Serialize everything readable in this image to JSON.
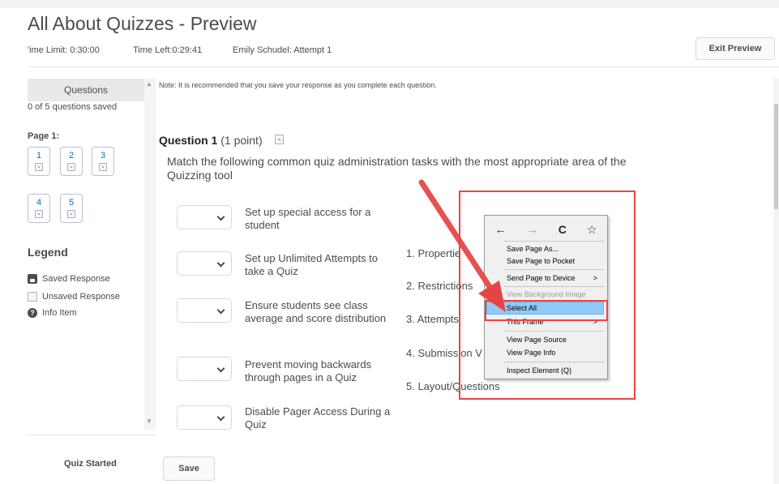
{
  "header": {
    "title": "All About Quizzes - Preview",
    "time_limit": "'ime Limit: 0:30:00",
    "time_left": "Time Left:0:29:41",
    "attempt": "Emily Schudel: Attempt 1",
    "exit_label": "Exit Preview"
  },
  "sidebar": {
    "header": "Questions",
    "saved_count": "0 of 5 questions saved",
    "page_label": "Page 1:",
    "questions": [
      "1",
      "2",
      "3",
      "4",
      "5"
    ],
    "legend_title": "Legend",
    "legend": {
      "saved": "Saved Response",
      "unsaved": "Unsaved Response",
      "info": "Info Item"
    },
    "quiz_started": "Quiz Started",
    "save_label": "Save"
  },
  "main": {
    "note": "Note: It is recommended that you save your response as you complete each question.",
    "question_title": "Question 1",
    "question_points": "(1 point)",
    "question_text": "Match the following common quiz administration tasks with the most appropriate area of the Quizzing tool",
    "matches": [
      "Set up special access for a student",
      "Set up Unlimited Attempts to take a Quiz",
      "Ensure students see class average and score distribution",
      "Prevent moving backwards through pages in a Quiz",
      "Disable Pager Access During a Quiz"
    ],
    "choices": [
      "1.  Propertie",
      "2.  Restrictions",
      "3.  Attempts",
      "4.  Submission V",
      "5.  Layout/Questions"
    ]
  },
  "context_menu": {
    "nav": {
      "back_icon": "←",
      "forward_icon": "→",
      "reload_icon": "C",
      "bookmark_icon": "☆"
    },
    "items": {
      "save_page_as": "Save Page As...",
      "save_to_pocket": "Save Page to Pocket",
      "send_to_device": "Send Page to Device",
      "view_bg_image": "View Background Image",
      "select_all": "Select All",
      "this_frame": "This Frame",
      "view_source": "View Page Source",
      "view_info": "View Page Info",
      "inspect": "Inspect Element (Q)"
    },
    "submenu_glyph": ">"
  },
  "colors": {
    "accent_red": "#e44444",
    "link_blue": "#006fbf",
    "menu_selection": "#91c9f7"
  }
}
